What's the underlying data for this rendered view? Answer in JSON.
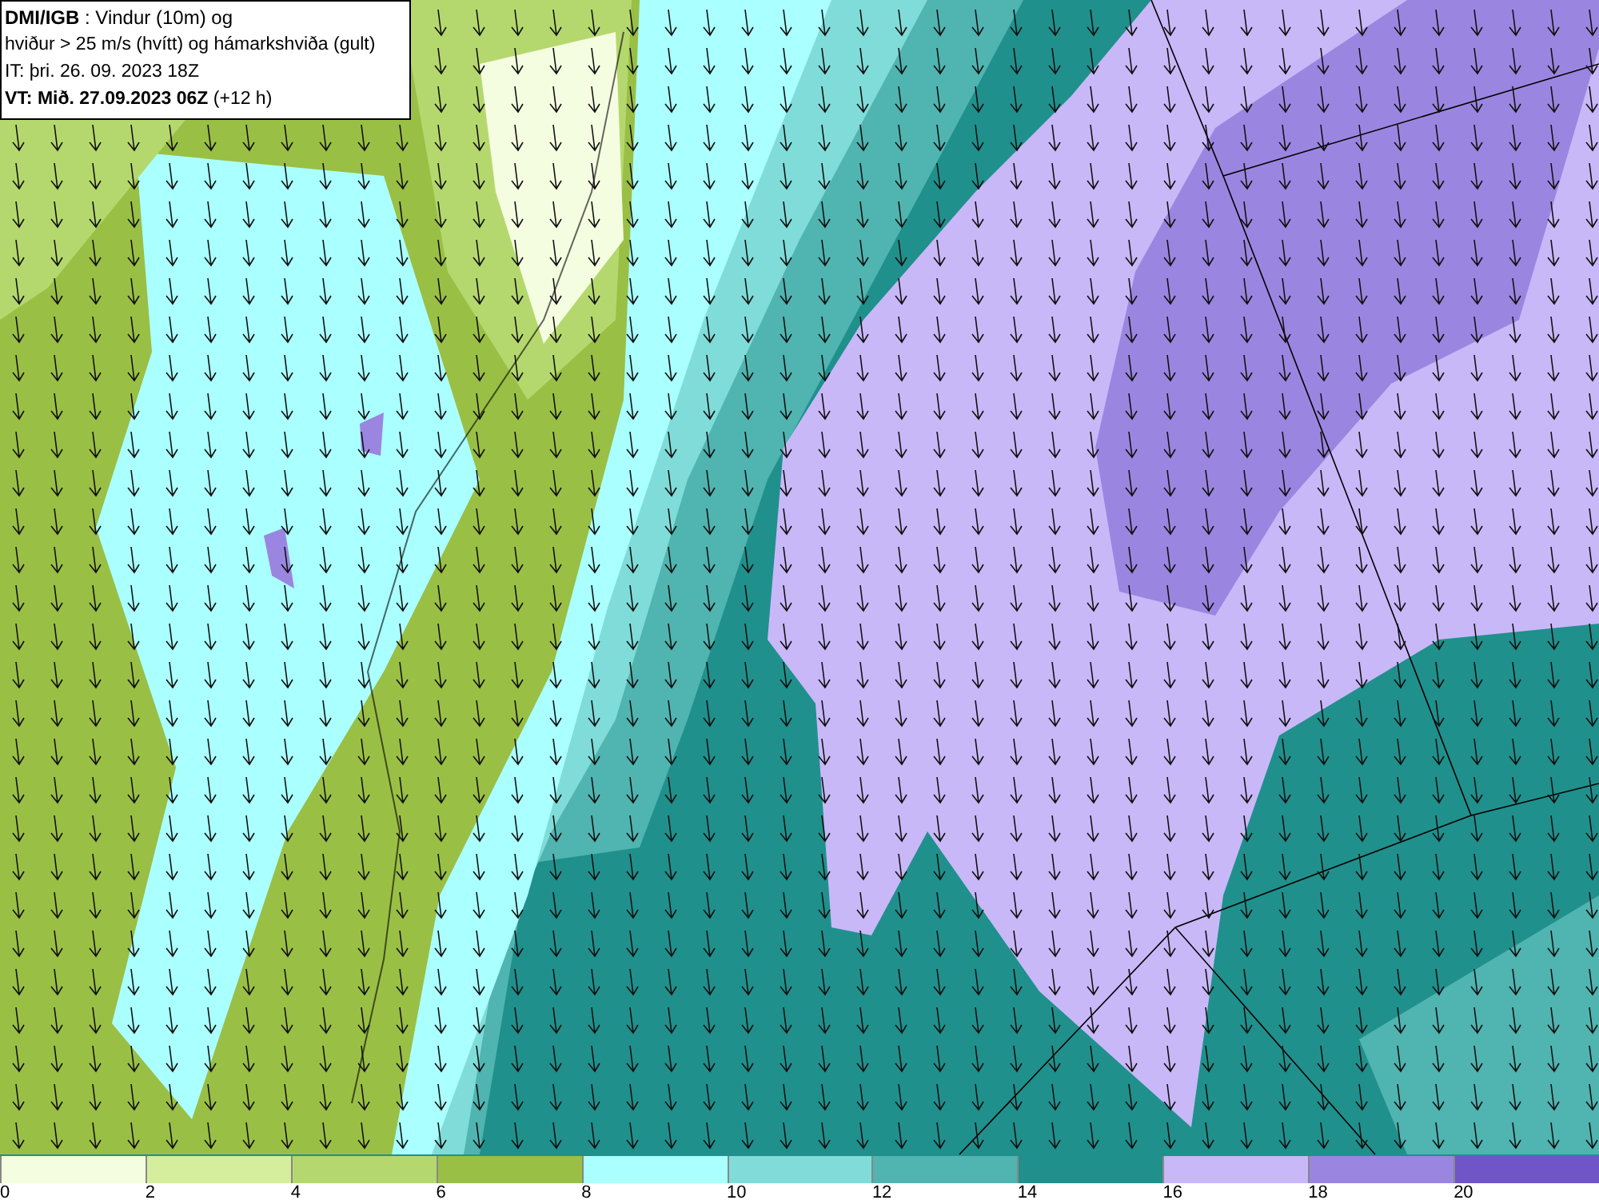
{
  "header": {
    "lines": [
      "**DMI/IGB** : Vindur (10m) og",
      "hviður > 25 m/s (hvítt) og hámarkshviða (gult)",
      "IT: þri. 26. 09. 2023 18Z",
      "**VT: Mið. 27.09.2023 06Z** (+12 h)"
    ]
  },
  "legend": [
    {
      "label": "0",
      "color": "#f5fde0"
    },
    {
      "label": "2",
      "color": "#d5ee9e"
    },
    {
      "label": "4",
      "color": "#b5d86e"
    },
    {
      "label": "6",
      "color": "#9abf45"
    },
    {
      "label": "8",
      "color": "#aaffff"
    },
    {
      "label": "10",
      "color": "#80dcd8"
    },
    {
      "label": "12",
      "color": "#50b4b0"
    },
    {
      "label": "14",
      "color": "#20908c"
    },
    {
      "label": "16",
      "color": "#c8b8f8"
    },
    {
      "label": "18",
      "color": "#9a86e0"
    },
    {
      "label": "20",
      "color": "#7055c8"
    }
  ]
}
